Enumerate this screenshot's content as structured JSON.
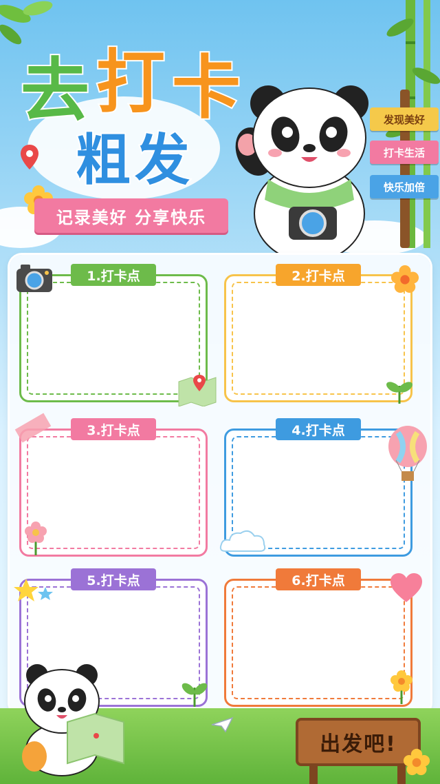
{
  "hero": {
    "title_line1": [
      "去",
      "打",
      "卡"
    ],
    "title_line2": "粗发",
    "ribbon_text": "记录美好 分享快乐"
  },
  "signpost": {
    "items": [
      "发现美好",
      "打卡生活",
      "快乐加倍"
    ]
  },
  "cards": [
    {
      "label": "1.打卡点",
      "color": "#6dbb4a"
    },
    {
      "label": "2.打卡点",
      "color": "#f7a52c"
    },
    {
      "label": "3.打卡点",
      "color": "#f27aa1"
    },
    {
      "label": "4.打卡点",
      "color": "#3e9be0"
    },
    {
      "label": "5.打卡点",
      "color": "#9b72d6"
    },
    {
      "label": "6.打卡点",
      "color": "#f07a3a"
    }
  ],
  "footer": {
    "go_sign": "出发吧!"
  },
  "colors": {
    "title_green": "#58b947",
    "title_orange": "#f7941d",
    "title_blue": "#2f8fe0",
    "ribbon_pink": "#f27aa1"
  },
  "icons": [
    "camera-icon",
    "map-pin-icon",
    "flower-icon",
    "map-icon",
    "hot-air-balloon-icon",
    "star-icon",
    "heart-icon",
    "cloud-icon",
    "paper-plane-icon",
    "bamboo-icon",
    "panda-character"
  ]
}
